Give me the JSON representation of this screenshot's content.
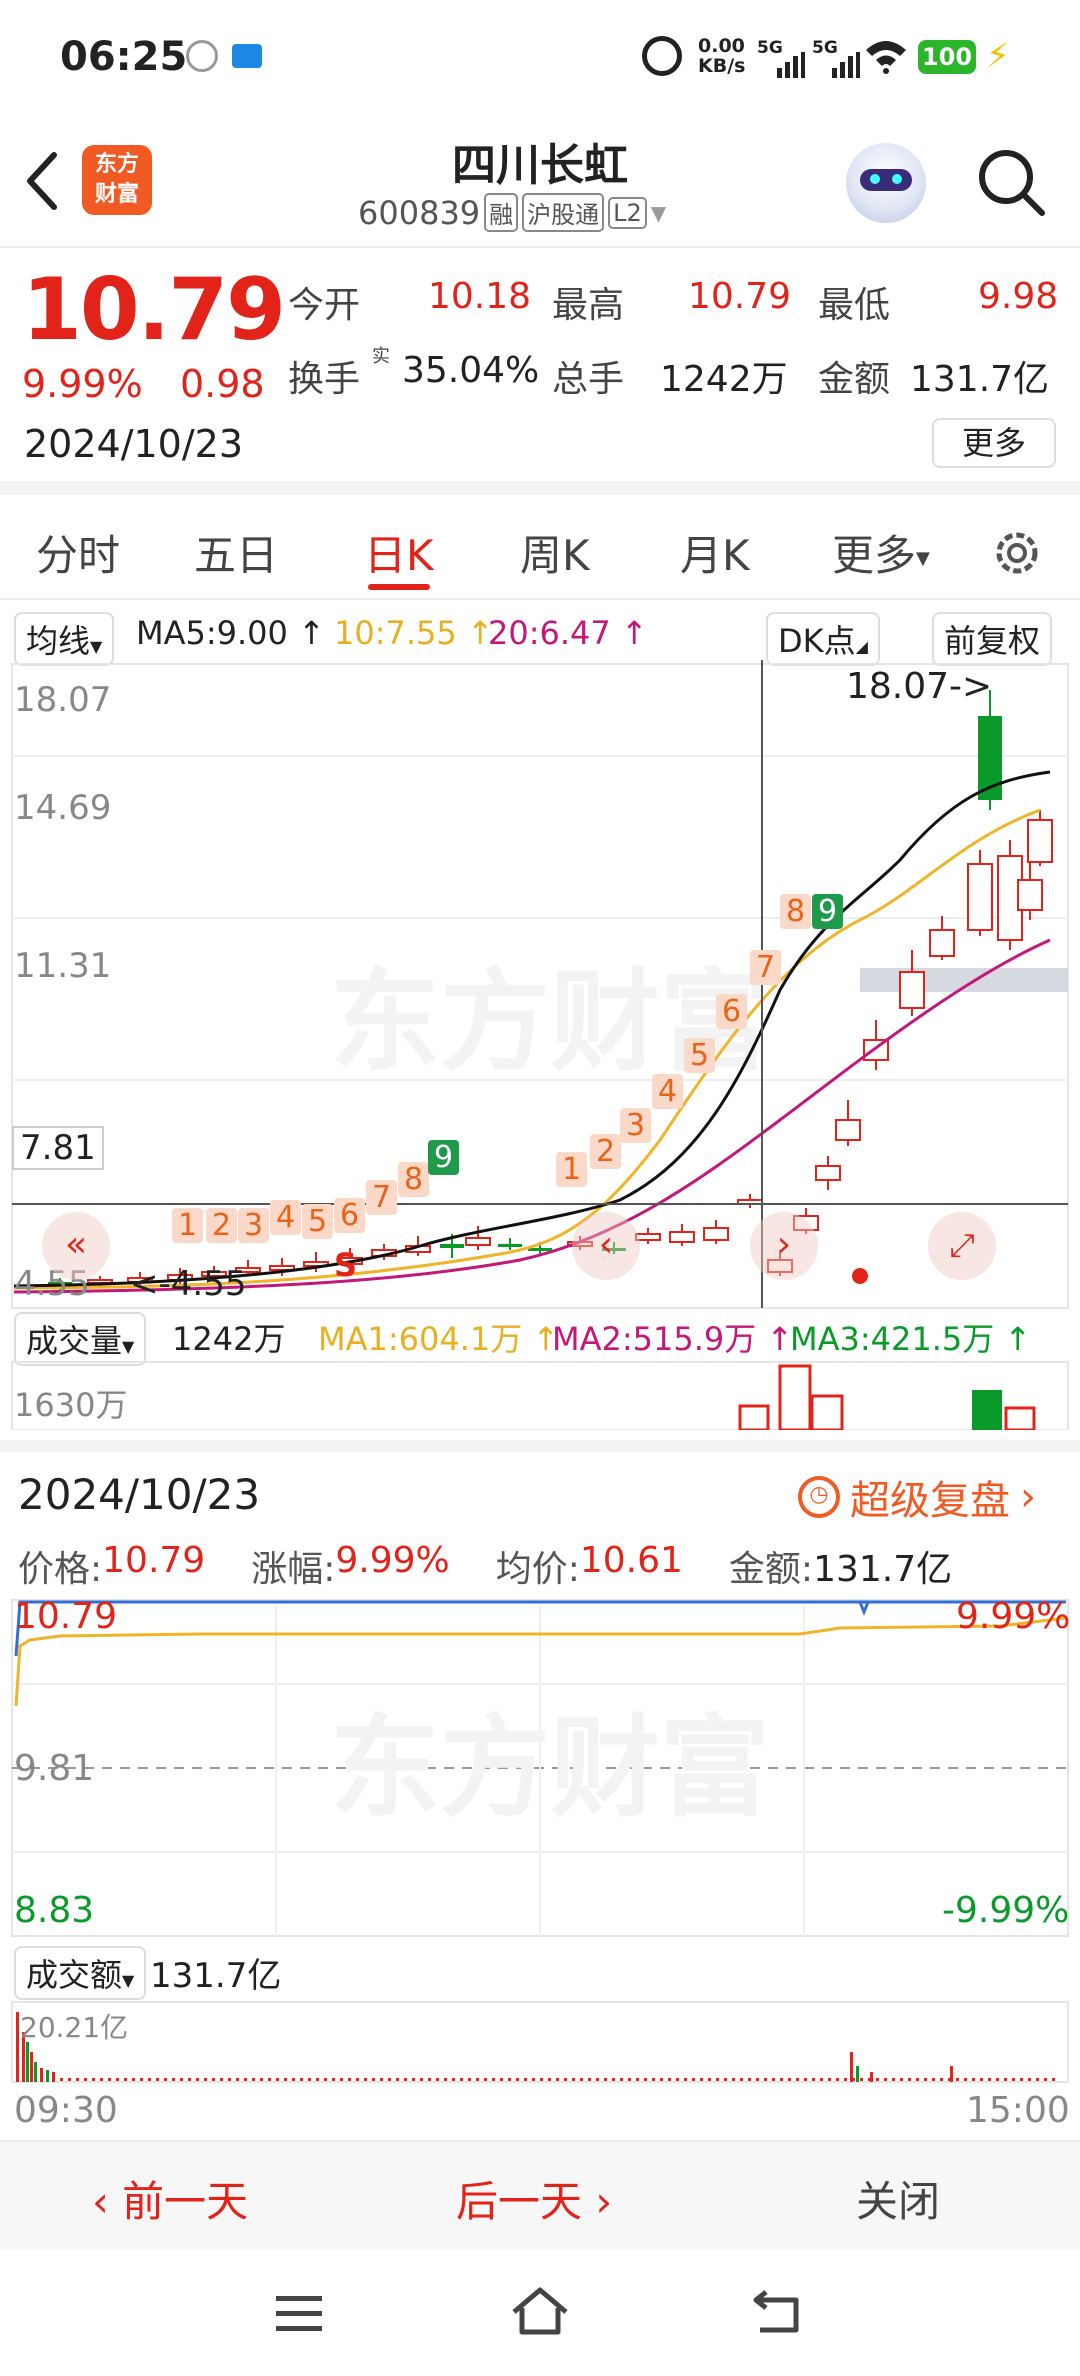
{
  "status_bar": {
    "time": "06:25",
    "net_speed_top": "0.00",
    "net_speed_bottom": "KB/s",
    "sig1": "5G",
    "sig2": "5G",
    "battery": "100"
  },
  "header": {
    "logo_line1": "东方",
    "logo_line2": "财富",
    "title": "四川长虹",
    "code": "600839",
    "tags": [
      "融",
      "沪股通",
      "L2"
    ]
  },
  "quote": {
    "price": "10.79",
    "change_pct": "9.99%",
    "change": "0.98",
    "date": "2024/10/23",
    "open_label": "今开",
    "open": "10.18",
    "high_label": "最高",
    "high": "10.79",
    "low_label": "最低",
    "low": "9.98",
    "turnover_label": "换手",
    "turnover_sup": "实",
    "turnover": "35.04%",
    "volume_label": "总手",
    "volume": "1242万",
    "amount_label": "金额",
    "amount": "131.7亿",
    "more": "更多"
  },
  "tabs": {
    "items": [
      "分时",
      "五日",
      "日K",
      "周K",
      "月K",
      "更多"
    ],
    "active": "日K"
  },
  "kline": {
    "ma_type": "均线",
    "ma5": "MA5:9.00 ↑",
    "ma10": "10:7.55 ↑",
    "ma20": "20:6.47 ↑",
    "dk": "DK点",
    "fq": "前复权",
    "y_labels": [
      "18.07",
      "14.69",
      "11.31",
      "7.81"
    ],
    "low_label": "4.55",
    "low_marker": "<-4.55",
    "high_marker": "18.07->",
    "crosshair_value": "7.81",
    "s_marker": "S",
    "seq_labels": [
      "1",
      "2",
      "3",
      "4",
      "5",
      "6",
      "7",
      "8",
      "9",
      "1",
      "2",
      "3",
      "4",
      "5",
      "6",
      "7",
      "8",
      "9"
    ],
    "watermark": "东方财富",
    "colors": {
      "up": "#e2231a",
      "down": "#0a9a2a",
      "ma5": "#111111",
      "ma10": "#f0b429",
      "ma20": "#c2187a"
    }
  },
  "volume": {
    "label": "成交量",
    "total": "1242万",
    "ma1": "MA1:604.1万 ↑",
    "ma2": "MA2:515.9万 ↑",
    "ma3": "MA3:421.5万 ↑",
    "axis_top": "1630万"
  },
  "detail": {
    "date": "2024/10/23",
    "replay": "超级复盘",
    "price_label": "价格:",
    "price": "10.79",
    "chg_label": "涨幅:",
    "chg": "9.99%",
    "avg_label": "均价:",
    "avg": "10.61",
    "amt_label": "金额:",
    "amt": "131.7亿",
    "y_top": "10.79",
    "y_mid": "9.81",
    "y_bot": "8.83",
    "pct_top": "9.99%",
    "pct_bot": "-9.99%",
    "amt_type": "成交额",
    "amt_total": "131.7亿",
    "amt_axis": "20.21亿",
    "t_start": "09:30",
    "t_end": "15:00",
    "watermark": "东方财富"
  },
  "bottom": {
    "prev": "前一天",
    "next": "后一天",
    "close": "关闭"
  }
}
